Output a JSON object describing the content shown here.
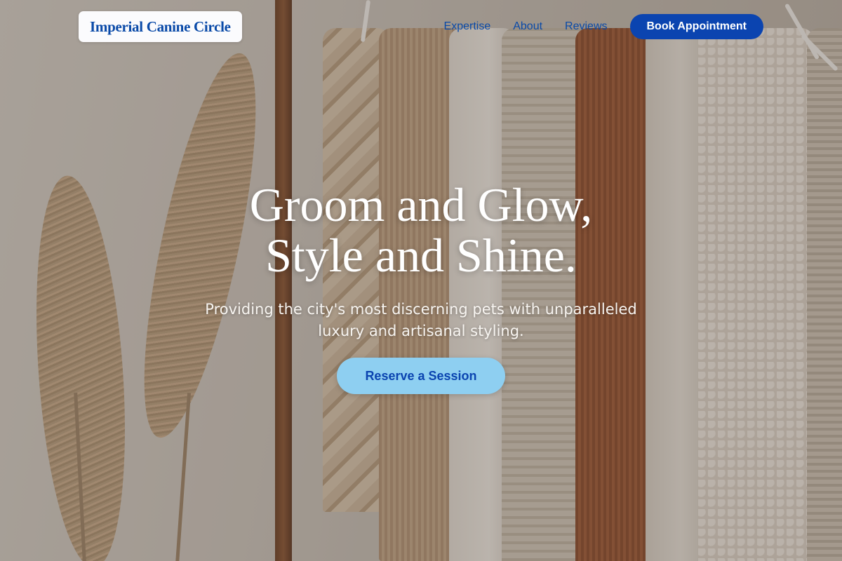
{
  "brand": {
    "name": "Imperial Canine Circle"
  },
  "nav": {
    "links": [
      "Expertise",
      "About",
      "Reviews"
    ],
    "cta_label": "Book Appointment"
  },
  "hero": {
    "title_line1": "Groom and Glow,",
    "title_line2": "Style and Shine.",
    "subtitle": "Providing the city's most discerning pets with unparalleled luxury and artisanal styling.",
    "cta_label": "Reserve a Session"
  },
  "colors": {
    "brand_blue": "#0b44b0",
    "cta_light_blue": "#8ecff1",
    "header_bg": "#fbfbfd"
  }
}
